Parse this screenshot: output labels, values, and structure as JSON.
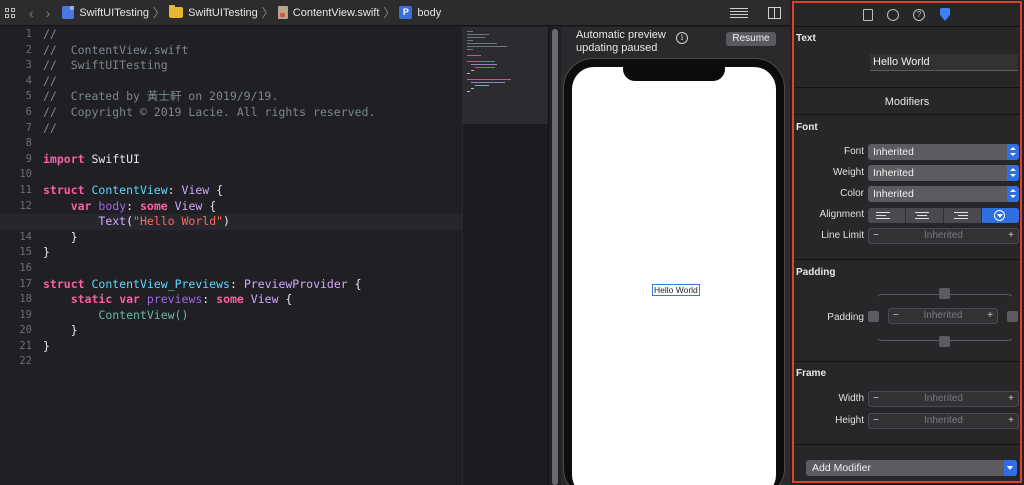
{
  "jumpbar": {
    "crumbs": [
      "SwiftUITesting",
      "SwiftUITesting",
      "ContentView.swift",
      "body"
    ],
    "icons": [
      "swift-project-icon",
      "folder-icon",
      "swift-file-icon",
      "property-icon"
    ]
  },
  "editor": {
    "line_numbers": [
      "1",
      "2",
      "3",
      "4",
      "5",
      "6",
      "7",
      "8",
      "9",
      "10",
      "11",
      "12",
      "13",
      "14",
      "15",
      "16",
      "17",
      "18",
      "19",
      "20",
      "21",
      "22"
    ],
    "active_line": "13",
    "comments": [
      "//",
      "//  ContentView.swift",
      "//  SwiftUITesting",
      "//",
      "//  Created by 黃士軒 on 2019/9/19.",
      "//  Copyright © 2019 Lacie. All rights reserved.",
      "//"
    ],
    "tokens": {
      "import": "import",
      "swiftui": "SwiftUI",
      "struct": "struct",
      "content_view": "ContentView",
      "colon_view": ": ",
      "view": "View",
      "brace_open": " {",
      "var": "var",
      "body": "body",
      "some": "some",
      "text": "Text",
      "hello_string": "\"Hello World\"",
      "brace_close": "}",
      "previews_struct": "ContentView_Previews",
      "preview_provider": "PreviewProvider",
      "static": "static",
      "previews": "previews",
      "content_view_call": "ContentView()"
    }
  },
  "preview": {
    "message": "Automatic preview updating paused",
    "resume_label": "Resume",
    "info_glyph": "i",
    "hello_text": "Hello World"
  },
  "inspector": {
    "tabs": [
      "file-inspector-icon",
      "history-icon",
      "quick-help-icon",
      "attributes-inspector-icon"
    ],
    "help_glyph": "?",
    "text_section": "Text",
    "text_value": "Hello World",
    "modifiers_title": "Modifiers",
    "font_section": "Font",
    "font_label": "Font",
    "font_value": "Inherited",
    "weight_label": "Weight",
    "weight_value": "Inherited",
    "color_label": "Color",
    "color_value": "Inherited",
    "alignment_label": "Alignment",
    "line_limit_label": "Line Limit",
    "line_limit_value": "Inherited",
    "padding_section": "Padding",
    "padding_label": "Padding",
    "padding_value": "Inherited",
    "frame_section": "Frame",
    "width_label": "Width",
    "width_value": "Inherited",
    "height_label": "Height",
    "height_value": "Inherited",
    "stepper_minus": "−",
    "stepper_plus": "+",
    "add_modifier_label": "Add Modifier"
  },
  "colors": {
    "keyword": "#fc5fa3",
    "type": "#d0a8ff",
    "string": "#fc6a5d",
    "comment": "#7c8890",
    "accent": "#2f6fe0",
    "inspector_border": "#e0402c"
  }
}
